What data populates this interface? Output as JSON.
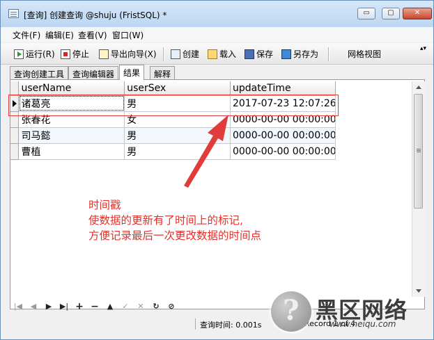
{
  "window": {
    "title": "[查询] 创建查询 @shuju (FristSQL) *",
    "min_symbol": "▭",
    "max_symbol": "▢",
    "close_symbol": "✕"
  },
  "menu": [
    "文件(F)",
    "编辑(E)",
    "查看(V)",
    "窗口(W)"
  ],
  "toolbar": {
    "run": "运行(R)",
    "stop": "停止",
    "export_wizard": "导出向导(X)",
    "create": "创建",
    "load": "载入",
    "save": "保存",
    "save_as": "另存为",
    "grid_view": "网格视图",
    "more": "▴▾"
  },
  "tabs": [
    "查询创建工具",
    "查询编辑器",
    "结果",
    "解释"
  ],
  "table": {
    "columns": [
      "userName",
      "userSex",
      "updateTime"
    ],
    "rows": [
      [
        "诸葛亮",
        "男",
        "2017-07-23 12:07:26"
      ],
      [
        "张春花",
        "女",
        "0000-00-00 00:00:00"
      ],
      [
        "司马懿",
        "男",
        "0000-00-00 00:00:00"
      ],
      [
        "曹植",
        "男",
        "0000-00-00 00:00:00"
      ]
    ]
  },
  "annotation": {
    "line1": "时间戳",
    "line2": "使数据的更新有了时间上的标记,",
    "line3": "方便记录最后一次更改数据的时间点",
    "color": "#e0322c"
  },
  "nav": {
    "first": "|◀",
    "prev": "◀",
    "next": "▶",
    "last": "▶|",
    "add": "+",
    "delete": "−",
    "up": "▲",
    "apply": "✓",
    "cancel": "✕",
    "refresh": "↻",
    "stop": "⊘"
  },
  "status": {
    "query_time": "查询时间: 0.001s",
    "record": "Record 1 of 4"
  },
  "watermark": {
    "title": "黑区网络",
    "url": "www.heiqu.com",
    "glyph": "?"
  }
}
